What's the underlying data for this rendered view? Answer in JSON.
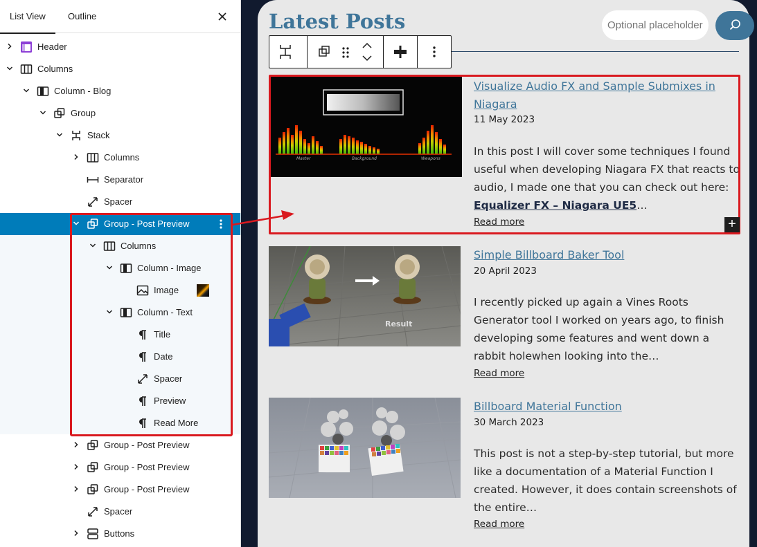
{
  "panel": {
    "tabs": [
      {
        "label": "List View",
        "active": true
      },
      {
        "label": "Outline",
        "active": false
      }
    ],
    "close_icon": "close-icon",
    "tree": [
      {
        "label": "Header",
        "icon": "template-part-icon",
        "level": 0,
        "expandable": true,
        "expanded": false
      },
      {
        "label": "Columns",
        "icon": "columns-icon",
        "level": 0,
        "expandable": true,
        "expanded": true
      },
      {
        "label": "Column - Blog",
        "icon": "column-icon",
        "level": 1,
        "expandable": true,
        "expanded": true
      },
      {
        "label": "Group",
        "icon": "group-icon",
        "level": 2,
        "expandable": true,
        "expanded": true
      },
      {
        "label": "Stack",
        "icon": "stack-icon",
        "level": 3,
        "expandable": true,
        "expanded": true
      },
      {
        "label": "Columns",
        "icon": "columns-icon",
        "level": 4,
        "expandable": true,
        "expanded": false
      },
      {
        "label": "Separator",
        "icon": "separator-icon",
        "level": 4,
        "expandable": false
      },
      {
        "label": "Spacer",
        "icon": "spacer-icon",
        "level": 4,
        "expandable": false
      },
      {
        "label": "Group - Post Preview",
        "icon": "group-icon",
        "level": 4,
        "expandable": true,
        "expanded": true,
        "selected": true
      },
      {
        "label": "Columns",
        "icon": "columns-icon",
        "level": 5,
        "expandable": true,
        "expanded": true,
        "inside": true
      },
      {
        "label": "Column - Image",
        "icon": "column-icon",
        "level": 6,
        "expandable": true,
        "expanded": true,
        "inside": true
      },
      {
        "label": "Image",
        "icon": "image-icon",
        "level": 7,
        "expandable": false,
        "inside": true,
        "thumb": true
      },
      {
        "label": "Column - Text",
        "icon": "column-icon",
        "level": 6,
        "expandable": true,
        "expanded": true,
        "inside": true
      },
      {
        "label": "Title",
        "icon": "paragraph-icon",
        "level": 7,
        "expandable": false,
        "inside": true
      },
      {
        "label": "Date",
        "icon": "paragraph-icon",
        "level": 7,
        "expandable": false,
        "inside": true
      },
      {
        "label": "Spacer",
        "icon": "spacer-icon",
        "level": 7,
        "expandable": false,
        "inside": true
      },
      {
        "label": "Preview",
        "icon": "paragraph-icon",
        "level": 7,
        "expandable": false,
        "inside": true
      },
      {
        "label": "Read More",
        "icon": "paragraph-icon",
        "level": 7,
        "expandable": false,
        "inside": true
      },
      {
        "label": "Group - Post Preview",
        "icon": "group-icon",
        "level": 4,
        "expandable": true,
        "expanded": false
      },
      {
        "label": "Group - Post Preview",
        "icon": "group-icon",
        "level": 4,
        "expandable": true,
        "expanded": false
      },
      {
        "label": "Group - Post Preview",
        "icon": "group-icon",
        "level": 4,
        "expandable": true,
        "expanded": false
      },
      {
        "label": "Spacer",
        "icon": "spacer-icon",
        "level": 4,
        "expandable": false
      },
      {
        "label": "Buttons",
        "icon": "buttons-icon",
        "level": 4,
        "expandable": true,
        "expanded": false
      }
    ]
  },
  "canvas": {
    "title": "Latest Posts",
    "search": {
      "placeholder": "Optional placeholder",
      "button_icon": "search-icon"
    },
    "toolbar": [
      "stack-icon",
      "group-icon",
      "drag-handle-icon",
      "move-up-down-icon",
      "justify-icon",
      "more-options-icon"
    ],
    "posts": [
      {
        "title": "Visualize Audio FX and Sample Submixes in Niagara",
        "date": "11 May 2023",
        "excerpt": "In this post I will cover some techniques I found useful when developing Niagara FX that reacts to audio, I made one that you can check out here: ",
        "excerpt_link": "Equalizer FX – Niagara UE5",
        "excerpt_tail": "…",
        "read_more": "Read more",
        "image_labels": [
          "Master",
          "Background",
          "Weapons"
        ],
        "selected": true
      },
      {
        "title": "Simple Billboard Baker Tool",
        "date": "20 April 2023",
        "excerpt": "I recently picked up again a Vines Roots Generator tool I worked on years ago, to finish developing some features and went down a rabbit holewhen looking into the…",
        "read_more": "Read more",
        "image_labels": [
          "Result"
        ]
      },
      {
        "title": "Billboard Material Function",
        "date": "30 March 2023",
        "excerpt": "This post is not a step-by-step tutorial, but more like a documentation of a Material Function I created. However, it does contain screenshots of the entire…",
        "read_more": "Read more"
      }
    ],
    "add_block_icon": "plus-icon"
  },
  "colors": {
    "accent": "#007cba",
    "title": "#3f7599",
    "annotation": "#d9191f",
    "frame": "#111a2e"
  }
}
